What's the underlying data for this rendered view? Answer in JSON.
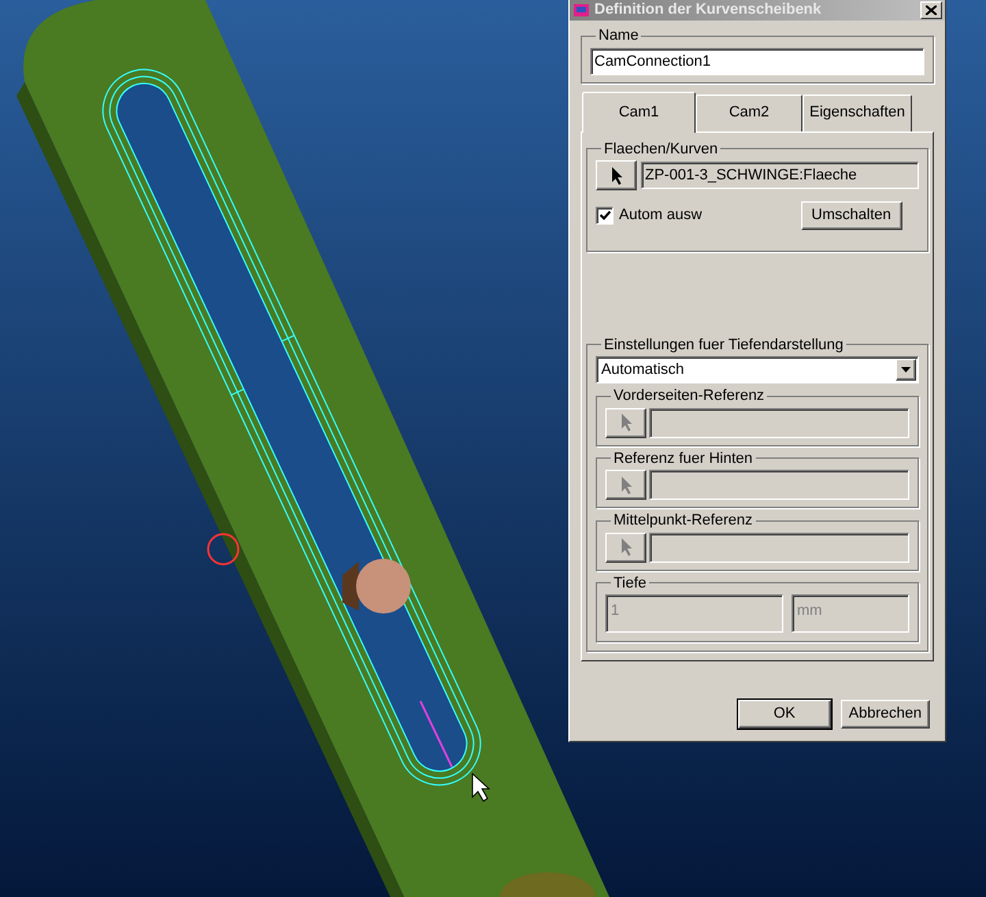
{
  "window": {
    "title": "Definition der Kurvenscheibenk"
  },
  "name_group": {
    "label": "Name",
    "value": "CamConnection1"
  },
  "tabs": [
    {
      "label": "Cam1",
      "selected": true
    },
    {
      "label": "Cam2",
      "selected": false
    },
    {
      "label": "Eigenschaften",
      "selected": false
    }
  ],
  "surfaces_group": {
    "label": "Flaechen/Kurven",
    "value": "ZP-001-3_SCHWINGE:Flaeche",
    "auto_select": {
      "label": "Autom ausw",
      "checked": true
    },
    "toggle_button": "Umschalten"
  },
  "depth_group": {
    "label": "Einstellungen fuer Tiefendarstellung",
    "mode": "Automatisch",
    "references": [
      {
        "label": "Vorderseiten-Referenz",
        "disabled": true
      },
      {
        "label": "Referenz fuer Hinten",
        "disabled": true
      },
      {
        "label": "Mittelpunkt-Referenz",
        "disabled": true
      }
    ],
    "depth": {
      "label": "Tiefe",
      "value": "1",
      "unit": "mm",
      "disabled": true
    }
  },
  "buttons": [
    {
      "label": "OK"
    },
    {
      "label": "Abbrechen"
    }
  ]
}
